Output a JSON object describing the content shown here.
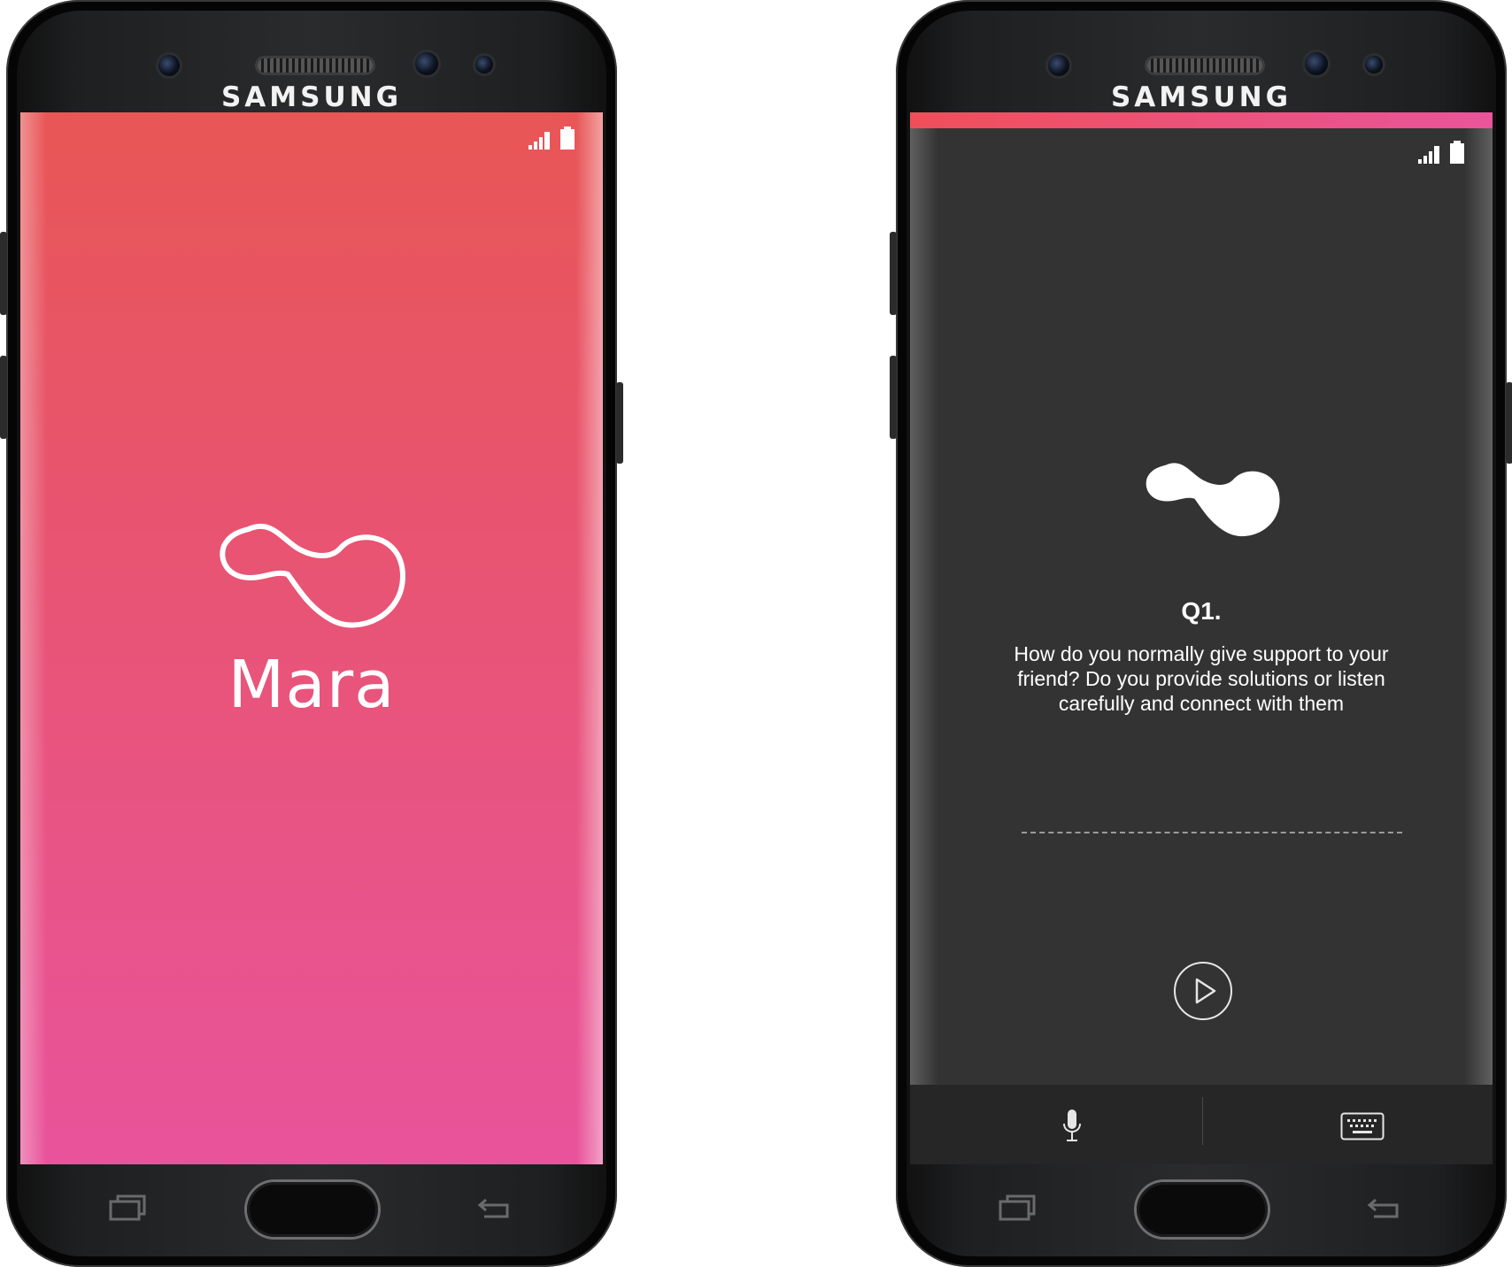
{
  "colors": {
    "splash_gradient_top": "#e85656",
    "splash_gradient_bottom": "#e8569a",
    "question_bg": "#333333",
    "accent_bar_start": "#ef4f5a",
    "accent_bar_end": "#e9559a"
  },
  "left_phone": {
    "brand": "SAMSUNG",
    "splash": {
      "logo_icon": "mara-blob-outline-icon",
      "app_name": "Mara"
    },
    "status_icons": [
      "signal-icon",
      "battery-icon"
    ],
    "nav_icons": [
      "recent-apps-icon",
      "home-button",
      "back-icon"
    ]
  },
  "right_phone": {
    "brand": "SAMSUNG",
    "question": {
      "logo_icon": "mara-blob-filled-icon",
      "number": "Q1.",
      "text": "How do you normally give support to your friend?  Do you provide solutions or listen carefully and connect with them"
    },
    "controls": {
      "play_icon": "play-icon",
      "mic_icon": "microphone-icon",
      "keyboard_icon": "keyboard-icon"
    },
    "status_icons": [
      "signal-icon",
      "battery-icon"
    ],
    "nav_icons": [
      "recent-apps-icon",
      "home-button",
      "back-icon"
    ]
  }
}
